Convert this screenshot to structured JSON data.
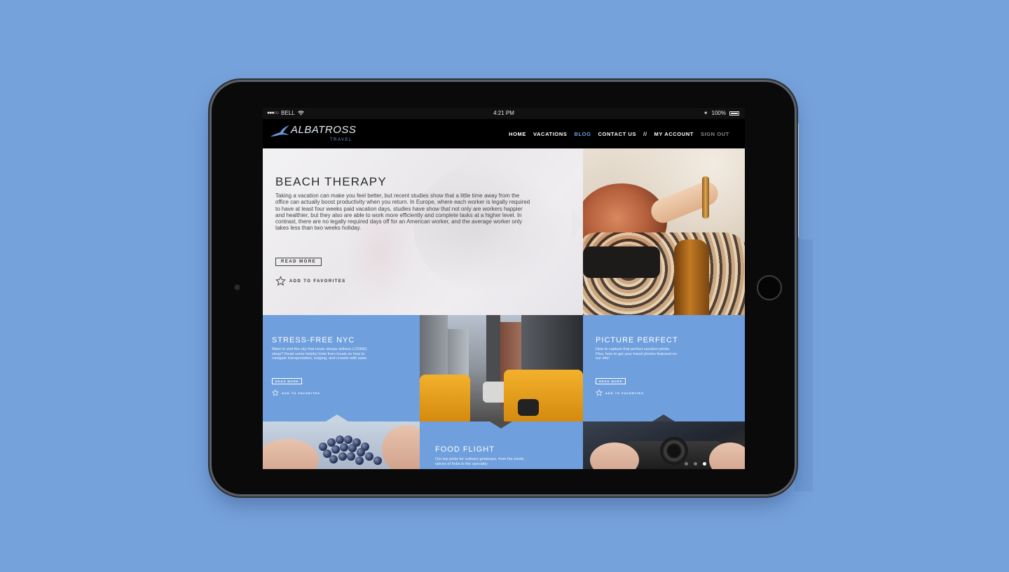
{
  "status_bar": {
    "carrier": "BELL",
    "time": "4:21 PM",
    "battery": "100%"
  },
  "brand": {
    "name": "ALBATROSS",
    "sub": "TRAVEL"
  },
  "nav": {
    "items": [
      "HOME",
      "VACATIONS",
      "BLOG",
      "CONTACT US"
    ],
    "separator": "//",
    "account": "MY ACCOUNT",
    "signout": "SIGN OUT",
    "active": "BLOG"
  },
  "hero": {
    "title": "BEACH THERAPY",
    "text": "Taking a vacation can make you feel better, but recent studies show that a little time away from the office can actually boost productivity when you return. In Europe, where each worker is legally required to have at least four weeks paid vacation days, studies have show that not only are workers happier and healthier, but they also are able to work more efficiently and complete tasks at a higher level. In contrast, there are no legally required days off for an American worker, and the average worker only takes less than two weeks holiday.",
    "read_more": "READ MORE",
    "favorite": "ADD TO FAVORITES"
  },
  "tiles": {
    "nyc": {
      "title": "STRESS-FREE NYC",
      "text": "Want to visit the city that never sleeps without LOSING sleep? Read some helpful hints from locals on how to navigate transportation, lodging, and crowds with ease.",
      "read_more": "READ MORE",
      "favorite": "ADD TO FAVORITES"
    },
    "picture": {
      "title": "PICTURE PERFECT",
      "text": "How to capture that perfect vacation photo. Plus, how to get your travel photos featured on our site!",
      "read_more": "READ MORE",
      "favorite": "ADD TO FAVORITES"
    },
    "food": {
      "title": "FOOD FLIGHT",
      "text": "Our top picks for culinary getaways, from the exotic spices of India to the specialty"
    }
  },
  "colors": {
    "background": "#76a2dc",
    "tile_blue": "#6f9fdd",
    "nav_active": "#6ea2e6"
  }
}
